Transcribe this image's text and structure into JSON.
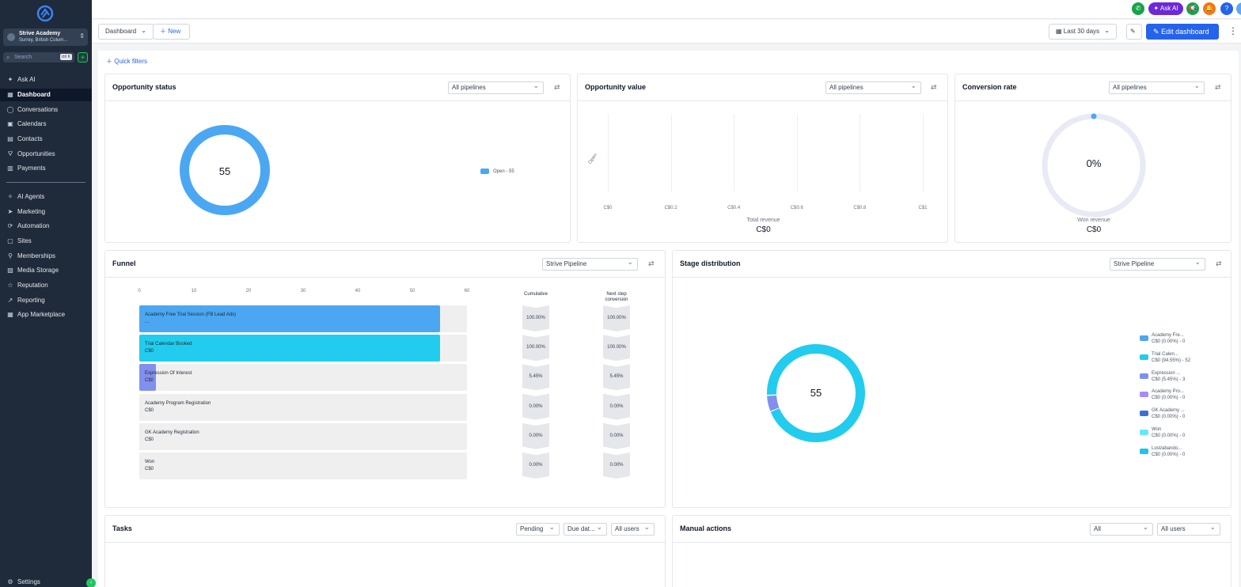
{
  "account": {
    "name": "Strive Academy",
    "location": "Surrey, British Colum..."
  },
  "search": {
    "placeholder": "Search",
    "shortcut": "ctrl K"
  },
  "nav": {
    "items": [
      {
        "label": "Ask AI",
        "icon": "sparkle-icon"
      },
      {
        "label": "Dashboard",
        "icon": "grid-icon"
      },
      {
        "label": "Conversations",
        "icon": "chat-icon"
      },
      {
        "label": "Calendars",
        "icon": "calendar-icon"
      },
      {
        "label": "Contacts",
        "icon": "contacts-icon"
      },
      {
        "label": "Opportunities",
        "icon": "filter-icon"
      },
      {
        "label": "Payments",
        "icon": "payments-icon"
      },
      {
        "label": "AI Agents",
        "icon": "agent-icon"
      },
      {
        "label": "Marketing",
        "icon": "send-icon"
      },
      {
        "label": "Automation",
        "icon": "automation-icon"
      },
      {
        "label": "Sites",
        "icon": "sites-icon"
      },
      {
        "label": "Memberships",
        "icon": "membership-icon"
      },
      {
        "label": "Media Storage",
        "icon": "media-icon"
      },
      {
        "label": "Reputation",
        "icon": "star-icon"
      },
      {
        "label": "Reporting",
        "icon": "chart-icon"
      },
      {
        "label": "App Marketplace",
        "icon": "apps-icon"
      }
    ],
    "settings": "Settings"
  },
  "topbar": {
    "ask_ai": "Ask AI",
    "help": "?"
  },
  "header": {
    "dashboard": "Dashboard",
    "new": "New",
    "date_range": "Last 30 days",
    "edit": "Edit dashboard"
  },
  "quick_filters": "Quick filters",
  "opportunity_status": {
    "title": "Opportunity status",
    "filter": "All pipelines",
    "center": "55",
    "legend": "Open - 55"
  },
  "opportunity_value": {
    "title": "Opportunity value",
    "filter": "All pipelines",
    "y_label": "Open",
    "x_ticks": [
      "C$0",
      "C$0.2",
      "C$0.4",
      "C$0.6",
      "C$0.8",
      "C$1"
    ],
    "footer_label": "Total revenue",
    "footer_value": "C$0"
  },
  "conversion_rate": {
    "title": "Conversion rate",
    "filter": "All pipelines",
    "value": "0%",
    "footer_label": "Won revenue",
    "footer_value": "C$0",
    "fraction": 0
  },
  "funnel": {
    "title": "Funnel",
    "filter": "Strive Pipeline",
    "ticks": [
      "0",
      "10",
      "20",
      "30",
      "40",
      "50",
      "60"
    ],
    "max": 60,
    "cumulative_header": "Cumulative",
    "next_header": "Next step conversion",
    "stages": [
      {
        "name": "Academy Free Trial Session (FB Lead Ads)",
        "sub": "...",
        "value": 55,
        "color": "#4ba7f2",
        "cumulative": "100.00%",
        "next": "100.00%"
      },
      {
        "name": "Trial Calendar Booked",
        "sub": "C$0",
        "value": 55,
        "color": "#22ccee",
        "cumulative": "100.00%",
        "next": "100.00%"
      },
      {
        "name": "Expression Of Interest",
        "sub": "C$0",
        "value": 3,
        "color": "#8190ee",
        "cumulative": "5.45%",
        "next": "5.45%"
      },
      {
        "name": "Academy Program Registration",
        "sub": "C$0",
        "value": 0,
        "color": "#a78bfa",
        "cumulative": "0.00%",
        "next": "0.00%"
      },
      {
        "name": "GK Academy Registration",
        "sub": "C$0",
        "value": 0,
        "color": "#3b82f6",
        "cumulative": "0.00%",
        "next": "0.00%"
      },
      {
        "name": "Won",
        "sub": "C$0",
        "value": 0,
        "color": "#67e8f9",
        "cumulative": "0.00%",
        "next": "0.00%"
      }
    ]
  },
  "stage_distribution": {
    "title": "Stage distribution",
    "filter": "Strive Pipeline",
    "center": "55",
    "items": [
      {
        "l1": "Academy Fre...",
        "l2": "C$0 (0.00%) - 0",
        "color": "#4ba7f2",
        "value": 0
      },
      {
        "l1": "Trial Calen...",
        "l2": "C$0 (94.55%) - 52",
        "color": "#22ccee",
        "value": 52
      },
      {
        "l1": "Expression ...",
        "l2": "C$0 (5.45%) - 3",
        "color": "#8190ee",
        "value": 3
      },
      {
        "l1": "Academy Pro...",
        "l2": "C$0 (0.00%) - 0",
        "color": "#a78bfa",
        "value": 0
      },
      {
        "l1": "GK Academy ...",
        "l2": "C$0 (0.00%) - 0",
        "color": "#3b6fd9",
        "value": 0
      },
      {
        "l1": "Won",
        "l2": "C$0 (0.00%) - 0",
        "color": "#67e8f9",
        "value": 0
      },
      {
        "l1": "Lost/abando...",
        "l2": "C$0 (0.00%) - 0",
        "color": "#22c3ee",
        "value": 0
      }
    ]
  },
  "tasks": {
    "title": "Tasks",
    "f1": "Pending",
    "f2": "Due dat...",
    "f3": "All users"
  },
  "manual_actions": {
    "title": "Manual actions",
    "f1": "All",
    "f2": "All users"
  },
  "chart_data": [
    {
      "type": "pie",
      "title": "Opportunity status",
      "categories": [
        "Open"
      ],
      "values": [
        55
      ]
    },
    {
      "type": "bar",
      "title": "Opportunity value",
      "categories": [
        "Open"
      ],
      "values": [
        0
      ],
      "xlabel": "Total revenue",
      "xlim": [
        0,
        1
      ]
    },
    {
      "type": "bar",
      "title": "Funnel",
      "categories": [
        "Academy Free Trial Session (FB Lead Ads)",
        "Trial Calendar Booked",
        "Expression Of Interest",
        "Academy Program Registration",
        "GK Academy Registration",
        "Won"
      ],
      "values": [
        55,
        55,
        3,
        0,
        0,
        0
      ],
      "xlim": [
        0,
        60
      ]
    },
    {
      "type": "pie",
      "title": "Stage distribution",
      "categories": [
        "Academy Fre...",
        "Trial Calen...",
        "Expression ...",
        "Academy Pro...",
        "GK Academy ...",
        "Won",
        "Lost/abando..."
      ],
      "values": [
        0,
        52,
        3,
        0,
        0,
        0,
        0
      ]
    }
  ]
}
